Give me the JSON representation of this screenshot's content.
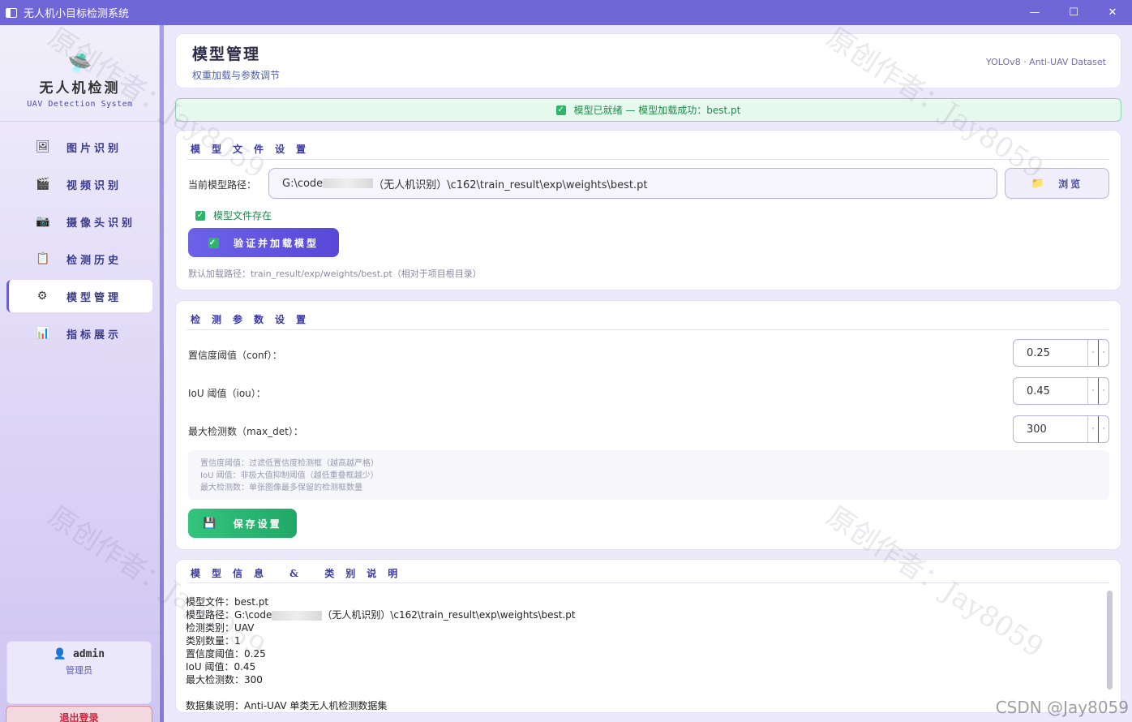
{
  "window": {
    "title": "无人机小目标检测系统",
    "minimize": "—",
    "maximize": "☐",
    "close": "✕"
  },
  "sidebar": {
    "logo_icon": "🛸",
    "app_name": "无人机检测",
    "app_subtitle": "UAV Detection System",
    "items": [
      {
        "icon": "🖼",
        "icon_name": "image-icon",
        "label": "图片识别"
      },
      {
        "icon": "🎬",
        "icon_name": "video-icon",
        "label": "视频识别"
      },
      {
        "icon": "📷",
        "icon_name": "camera-icon",
        "label": "摄像头识别"
      },
      {
        "icon": "📋",
        "icon_name": "history-icon",
        "label": "检测历史"
      },
      {
        "icon": "⚙",
        "icon_name": "gear-icon",
        "label": "模型管理",
        "active": true
      },
      {
        "icon": "📊",
        "icon_name": "chart-icon",
        "label": "指标展示"
      }
    ],
    "user": {
      "icon": "👤",
      "name": "admin",
      "role": "管理员"
    },
    "logout_label": "退出登录"
  },
  "header": {
    "title": "模型管理",
    "subtitle": "权重加载与参数调节",
    "tag": "YOLOv8 · Anti-UAV Dataset"
  },
  "banner": {
    "icon": "✓",
    "text": "模型已就绪 — 模型加载成功：best.pt"
  },
  "model_file": {
    "section_title": "模型文件设置",
    "path_label": "当前模型路径：",
    "path_value_prefix": "G:\\code",
    "path_value_suffix": "（无人机识别）\\c162\\train_result\\exp\\weights\\best.pt",
    "browse_icon": "📁",
    "browse_label": "浏览",
    "exists_icon": "✓",
    "exists_text": "模型文件存在",
    "verify_icon": "✓",
    "verify_label": "验证并加载模型",
    "default_hint": "默认加载路径：train_result/exp/weights/best.pt（相对于项目根目录）"
  },
  "params": {
    "section_title": "检测参数设置",
    "rows": [
      {
        "label": "置信度阈值（conf）：",
        "value": "0.25"
      },
      {
        "label": "IoU 阈值（iou）：",
        "value": "0.45"
      },
      {
        "label": "最大检测数（max_det）：",
        "value": "300"
      }
    ],
    "spin_up": "·",
    "spin_down": "·",
    "hints": [
      "置信度阈值：过滤低置信度检测框（越高越严格）",
      "IoU 阈值：非极大值抑制阈值（越低重叠框越少）",
      "最大检测数：单张图像最多保留的检测框数量"
    ],
    "save_icon": "💾",
    "save_label": "保存设置"
  },
  "model_info": {
    "section_title": "模型信息 & 类别说明",
    "lines": {
      "file": "模型文件：best.pt",
      "path_prefix": "模型路径：G:\\code",
      "path_suffix": "（无人机识别）\\c162\\train_result\\exp\\weights\\best.pt",
      "classes": "检测类别：UAV",
      "count": "类别数量：1",
      "conf": "置信度阈值：0.25",
      "iou": "IoU 阈值：0.45",
      "max_det": "最大检测数：300",
      "dataset": "数据集说明：Anti-UAV 单类无人机检测数据集"
    }
  },
  "watermarks": {
    "author": "原创作者：Jay8059",
    "csdn": "CSDN @Jay8059"
  }
}
